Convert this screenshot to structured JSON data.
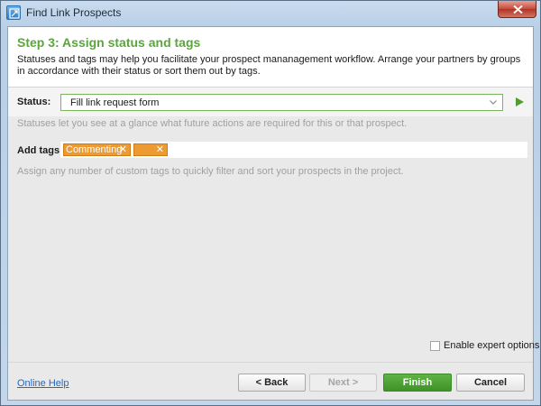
{
  "window": {
    "title": "Find Link Prospects"
  },
  "header": {
    "step_title": "Step 3: Assign status and tags",
    "description": "Statuses and tags may help you facilitate your prospect mananagement workflow. Arrange your partners by groups in accordance with their status or sort them out by tags."
  },
  "status": {
    "label": "Status:",
    "value": "Fill link request form",
    "hint": "Statuses let you see at a glance what future actions are required for this or that prospect."
  },
  "tags": {
    "label": "Add tags:",
    "items": [
      {
        "text": "Commenting",
        "remove": "✕"
      },
      {
        "text": "",
        "remove": "✕"
      }
    ],
    "hint": "Assign any number of custom tags to quickly filter and sort your prospects in the project."
  },
  "options": {
    "expert_label": "Enable expert options",
    "expert_checked": false
  },
  "footer": {
    "help_link": "Online Help",
    "back_label": "< Back",
    "next_label": "Next >",
    "finish_label": "Finish",
    "cancel_label": "Cancel"
  },
  "colors": {
    "accent_green": "#5aa63b",
    "tag_orange": "#ec9a32",
    "link_blue": "#2a66b9",
    "close_red": "#c7493a"
  },
  "icons": {
    "app": "app-window-icon",
    "close": "close-icon",
    "dropdown": "chevron-down-icon",
    "apply": "play-arrow-icon",
    "tag_remove": "close-icon"
  }
}
